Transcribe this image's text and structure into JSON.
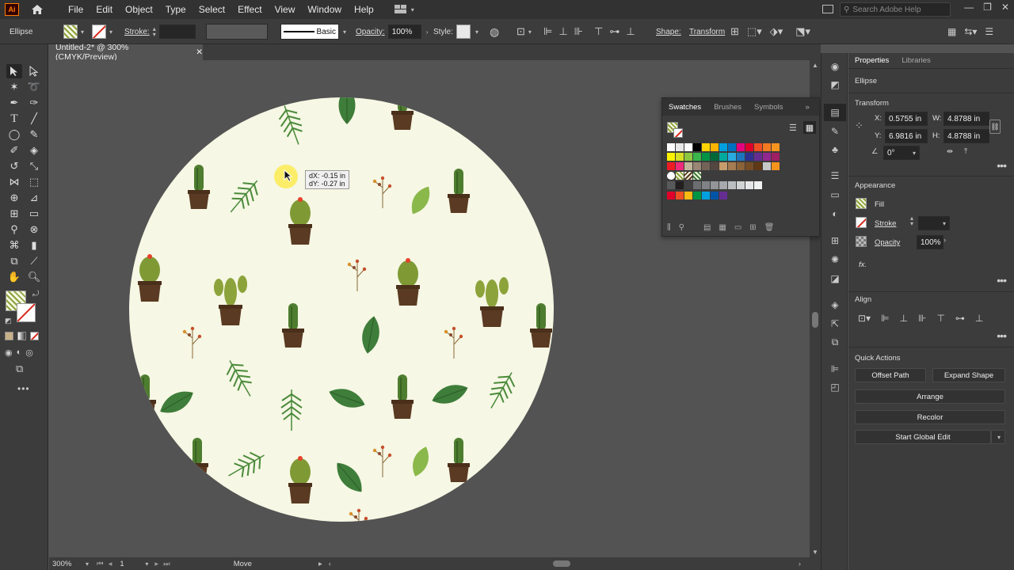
{
  "app": {
    "logo": "Ai"
  },
  "menu": [
    "File",
    "Edit",
    "Object",
    "Type",
    "Select",
    "Effect",
    "View",
    "Window",
    "Help"
  ],
  "search": {
    "placeholder": "Search Adobe Help"
  },
  "controlbar": {
    "object_type": "Ellipse",
    "stroke_label": "Stroke:",
    "brush_label": "Basic",
    "opacity_label": "Opacity:",
    "opacity_value": "100%",
    "style_label": "Style:",
    "shape_label": "Shape:",
    "transform_label": "Transform"
  },
  "document": {
    "tab_title": "Untitled-2* @ 300% (CMYK/Preview)"
  },
  "tooltip": {
    "dx": "dX: -0.15 in",
    "dy": "dY: -0.27 in"
  },
  "status": {
    "zoom": "300%",
    "artboard": "1",
    "tool": "Move"
  },
  "swatches_panel": {
    "tabs": [
      "Swatches",
      "Brushes",
      "Symbols"
    ],
    "row1": [
      "#ffffff",
      "#e8e8e8",
      "#ffffff",
      "#000000",
      "#ffd400",
      "#ffb400",
      "#00a0e0",
      "#0070c0",
      "#e6007e",
      "#e0002a",
      "#f04e23",
      "#f47920",
      "#f7941d"
    ],
    "row2": [
      "#fff200",
      "#d7df23",
      "#8dc63f",
      "#39b54a",
      "#009444",
      "#006838",
      "#00a99d",
      "#29abe2",
      "#1c75bc",
      "#2e3192",
      "#662d91",
      "#92278f",
      "#9e1f63"
    ],
    "row3": [
      "#ed1c24",
      "#ee2a7b",
      "#c2b59b",
      "#998675",
      "#736357",
      "#534741",
      "#c69c6d",
      "#a67c52",
      "#8c6239",
      "#754c24",
      "#603813",
      "#c8c8c8",
      "#f7941d"
    ],
    "row4": [
      "#58595b",
      "#231f20",
      "#404041",
      "#6d6e71",
      "#808285",
      "#939598",
      "#a7a9ac",
      "#bcbec0",
      "#d1d3d4",
      "#e6e7e8",
      "#f1f2f2"
    ],
    "row5": [
      "#e0002a",
      "#f04e23",
      "#fdb913",
      "#009444",
      "#00a0e0",
      "#0054a6",
      "#662d91"
    ]
  },
  "properties": {
    "tabs": [
      "Properties",
      "Libraries"
    ],
    "object": "Ellipse",
    "transform_title": "Transform",
    "x_label": "X:",
    "x_value": "0.5755 in",
    "y_label": "Y:",
    "y_value": "6.9816 in",
    "w_label": "W:",
    "w_value": "4.8788 in",
    "h_label": "H:",
    "h_value": "4.8788 in",
    "angle_value": "0°",
    "appearance_title": "Appearance",
    "fill_label": "Fill",
    "stroke_label": "Stroke",
    "opacity_label": "Opacity",
    "opacity_value": "100%",
    "fx_label": "fx.",
    "align_title": "Align",
    "quick_actions_title": "Quick Actions",
    "offset_path": "Offset Path",
    "expand_shape": "Expand Shape",
    "arrange": "Arrange",
    "recolor": "Recolor",
    "start_global_edit": "Start Global Edit"
  },
  "colors": {
    "accent_stroke": "#d6281b",
    "pattern_bg": "#f6f7e4",
    "cactus_green": "#8ca33b",
    "pot_brown": "#5a3a22",
    "leaf_green": "#3e7d3a"
  }
}
